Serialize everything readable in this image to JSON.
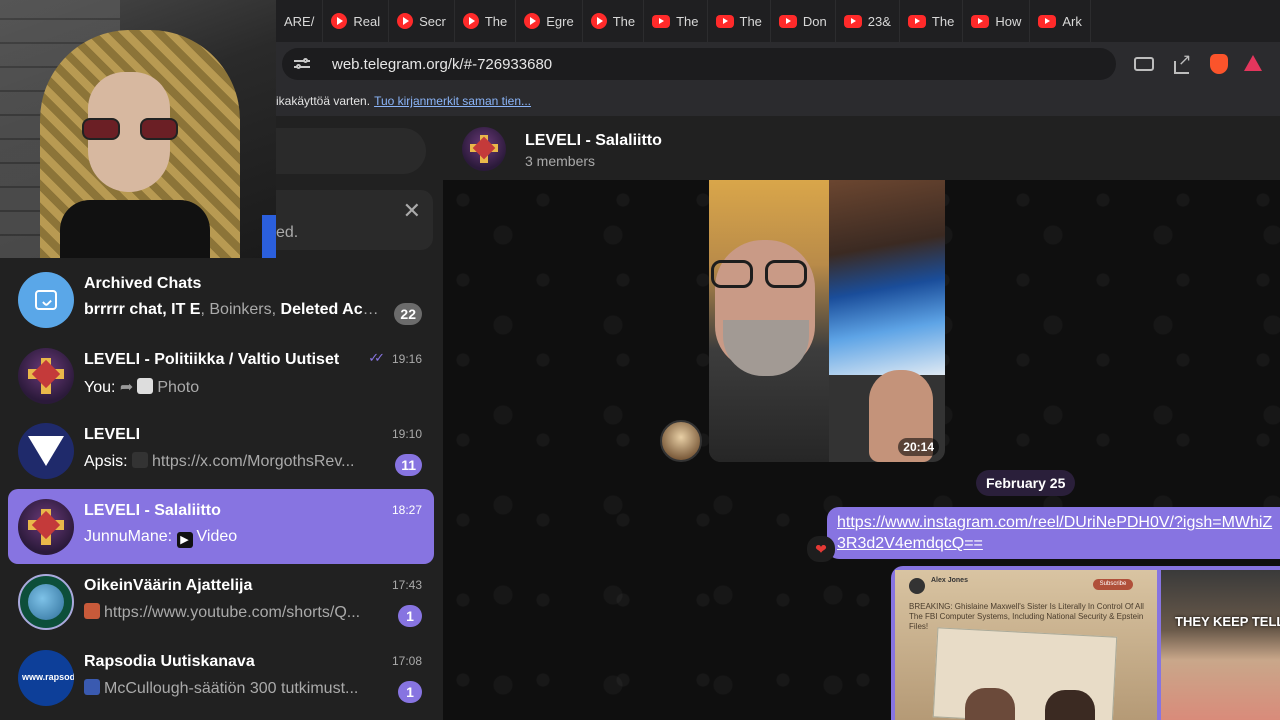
{
  "browser": {
    "tabs": [
      {
        "label": "ARE/",
        "icon": "none"
      },
      {
        "label": "Real",
        "icon": "youtube-round"
      },
      {
        "label": "Secr",
        "icon": "youtube-round"
      },
      {
        "label": "The",
        "icon": "youtube-round"
      },
      {
        "label": "Egre",
        "icon": "youtube-round"
      },
      {
        "label": "The",
        "icon": "youtube-round"
      },
      {
        "label": "The",
        "icon": "youtube"
      },
      {
        "label": "The",
        "icon": "youtube"
      },
      {
        "label": "Don",
        "icon": "youtube"
      },
      {
        "label": "23&",
        "icon": "youtube"
      },
      {
        "label": "The",
        "icon": "youtube"
      },
      {
        "label": "How",
        "icon": "youtube"
      },
      {
        "label": "Ark",
        "icon": "youtube"
      }
    ],
    "url": "web.telegram.org/k/#-726933680",
    "bookmarks_text": "ikakäyttöä varten.",
    "bookmarks_link": "Tuo kirjanmerkit saman tien..."
  },
  "sidebar": {
    "notice_text": "ed.",
    "notice_close": "✕",
    "chats": [
      {
        "title": "Archived Chats",
        "preview_bold": "brrrrr chat, IT E",
        "preview_rest": ", Boinkers, ",
        "preview_bold2": "Deleted Acc...",
        "time": "",
        "badge": "22"
      },
      {
        "title": "LEVELI - Politiikka / Valtio Uutiset",
        "sender": "You:",
        "preview": "Photo",
        "time": "19:16",
        "badge": ""
      },
      {
        "title": "LEVELI",
        "sender": "Apsis:",
        "preview": "https://x.com/MorgothsRev...",
        "time": "19:10",
        "badge": "11"
      },
      {
        "title": "LEVELI - Salaliitto",
        "sender": "JunnuMane:",
        "preview": "Video",
        "time": "18:27",
        "badge": ""
      },
      {
        "title": "OikeinVäärin Ajattelija",
        "sender": "",
        "preview": "https://www.youtube.com/shorts/Q...",
        "time": "17:43",
        "badge": "1"
      },
      {
        "title": "Rapsodia Uutiskanava",
        "sender": "",
        "preview": "McCullough-säätiön 300 tutkimust...",
        "time": "17:08",
        "badge": "1"
      }
    ],
    "rapsodia_avatar_text": "www.rapsodia.info"
  },
  "chat": {
    "title": "LEVELI - Salaliitto",
    "subtitle": "3 members",
    "video_duration": "20:14",
    "date_chip": "February 25",
    "link": "https://www.instagram.com/reel/DUriNePDH0V/?igsh=MWhiZ3R3d2V4emdqcQ==",
    "reaction": "❤",
    "image_author": "Alex Jones",
    "image_subscribe": "Subscribe",
    "image_headline": "BREAKING: Ghislaine Maxwell's Sister Is Literally In Control Of All The FBI Computer Systems, Including National Security & Epstein Files!",
    "image_overlay_text": "THEY KEEP TELLIN"
  },
  "colors": {
    "accent": "#8774e1",
    "panel": "#212121",
    "background": "#0f0f0f"
  }
}
